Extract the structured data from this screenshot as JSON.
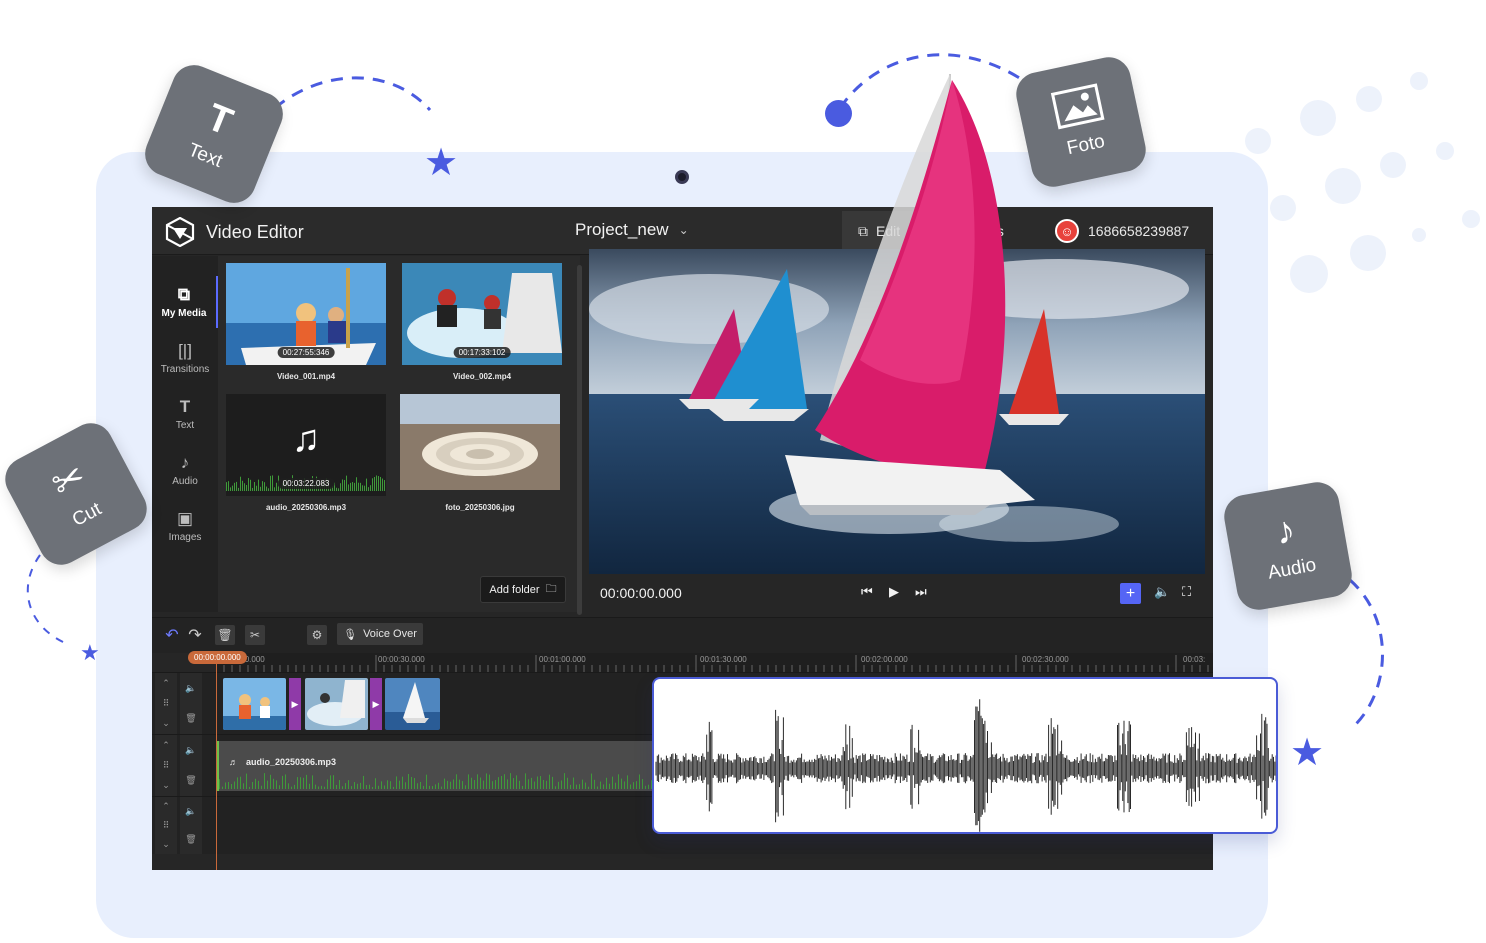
{
  "app": {
    "title": "Video Editor",
    "project_name": "Project_new",
    "tabs": [
      {
        "label": "Edit",
        "active": true
      },
      {
        "label": "Projects",
        "active": false
      }
    ],
    "user_id": "1686658239887"
  },
  "sidebar": {
    "items": [
      {
        "label": "My Media",
        "icon": "media-icon",
        "active": true
      },
      {
        "label": "Transitions",
        "icon": "transitions-icon",
        "active": false
      },
      {
        "label": "Text",
        "icon": "text-icon",
        "active": false
      },
      {
        "label": "Audio",
        "icon": "audio-icon",
        "active": false
      },
      {
        "label": "Images",
        "icon": "images-icon",
        "active": false
      }
    ]
  },
  "media": {
    "items": [
      {
        "name": "Video_001.mp4",
        "duration": "00:27:55:346",
        "kind": "video"
      },
      {
        "name": "Video_002.mp4",
        "duration": "00:17:33:102",
        "kind": "video"
      },
      {
        "name": "audio_20250306.mp3",
        "duration": "00:03:22.083",
        "kind": "audio"
      },
      {
        "name": "foto_20250306.jpg",
        "duration": "",
        "kind": "image"
      }
    ],
    "add_folder_label": "Add folder"
  },
  "player": {
    "timecode": "00:00:00.000"
  },
  "timeline": {
    "voice_over_label": "Voice Over",
    "playhead_label": "00:00:00.000",
    "ruler_labels": [
      "00:00:00.000",
      "00:00:30.000",
      "00:01:00.000",
      "00:01:30.000",
      "00:02:00.000",
      "00:02:30.000",
      "00:03:"
    ],
    "audio_clip_name": "audio_20250306.mp3"
  },
  "badges": {
    "text": "Text",
    "cut": "Cut",
    "foto": "Foto",
    "audio": "Audio"
  },
  "colors": {
    "accent": "#4a5be0",
    "app_bg": "#262626",
    "tablet_bg": "#e8effd",
    "transition": "#8f3aa8",
    "playhead": "#c9693a"
  }
}
